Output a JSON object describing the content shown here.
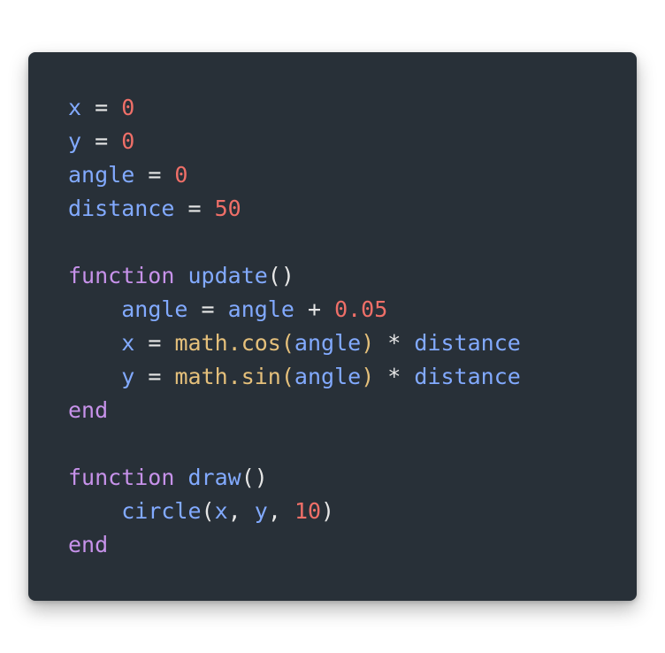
{
  "code": {
    "lines": [
      [
        {
          "t": "x",
          "k": "var"
        },
        {
          "t": " = ",
          "k": "op"
        },
        {
          "t": "0",
          "k": "num"
        }
      ],
      [
        {
          "t": "y",
          "k": "var"
        },
        {
          "t": " = ",
          "k": "op"
        },
        {
          "t": "0",
          "k": "num"
        }
      ],
      [
        {
          "t": "angle",
          "k": "var"
        },
        {
          "t": " = ",
          "k": "op"
        },
        {
          "t": "0",
          "k": "num"
        }
      ],
      [
        {
          "t": "distance",
          "k": "var"
        },
        {
          "t": " = ",
          "k": "op"
        },
        {
          "t": "50",
          "k": "num"
        }
      ],
      [],
      [
        {
          "t": "function",
          "k": "kw"
        },
        {
          "t": " ",
          "k": "op"
        },
        {
          "t": "update",
          "k": "fn"
        },
        {
          "t": "()",
          "k": "punc"
        }
      ],
      [
        {
          "t": "    ",
          "k": "op"
        },
        {
          "t": "angle",
          "k": "var"
        },
        {
          "t": " = ",
          "k": "op"
        },
        {
          "t": "angle",
          "k": "var"
        },
        {
          "t": " + ",
          "k": "op"
        },
        {
          "t": "0.05",
          "k": "num"
        }
      ],
      [
        {
          "t": "    ",
          "k": "op"
        },
        {
          "t": "x",
          "k": "var"
        },
        {
          "t": " = ",
          "k": "op"
        },
        {
          "t": "math.cos",
          "k": "lib"
        },
        {
          "t": "(",
          "k": "paren-y"
        },
        {
          "t": "angle",
          "k": "var"
        },
        {
          "t": ")",
          "k": "paren-y"
        },
        {
          "t": " * ",
          "k": "op"
        },
        {
          "t": "distance",
          "k": "var"
        }
      ],
      [
        {
          "t": "    ",
          "k": "op"
        },
        {
          "t": "y",
          "k": "var"
        },
        {
          "t": " = ",
          "k": "op"
        },
        {
          "t": "math.sin",
          "k": "lib"
        },
        {
          "t": "(",
          "k": "paren-y"
        },
        {
          "t": "angle",
          "k": "var"
        },
        {
          "t": ")",
          "k": "paren-y"
        },
        {
          "t": " * ",
          "k": "op"
        },
        {
          "t": "distance",
          "k": "var"
        }
      ],
      [
        {
          "t": "end",
          "k": "kw"
        }
      ],
      [],
      [
        {
          "t": "function",
          "k": "kw"
        },
        {
          "t": " ",
          "k": "op"
        },
        {
          "t": "draw",
          "k": "fn"
        },
        {
          "t": "()",
          "k": "punc"
        }
      ],
      [
        {
          "t": "    ",
          "k": "op"
        },
        {
          "t": "circle",
          "k": "fn"
        },
        {
          "t": "(",
          "k": "punc"
        },
        {
          "t": "x",
          "k": "var"
        },
        {
          "t": ", ",
          "k": "op"
        },
        {
          "t": "y",
          "k": "var"
        },
        {
          "t": ", ",
          "k": "op"
        },
        {
          "t": "10",
          "k": "num"
        },
        {
          "t": ")",
          "k": "punc"
        }
      ],
      [
        {
          "t": "end",
          "k": "kw"
        }
      ]
    ]
  },
  "colors": {
    "background": "#283038",
    "variable": "#82aaff",
    "number": "#ef6f68",
    "keyword": "#c792ea",
    "library": "#e5c07b",
    "operator": "#e6e6e6"
  }
}
